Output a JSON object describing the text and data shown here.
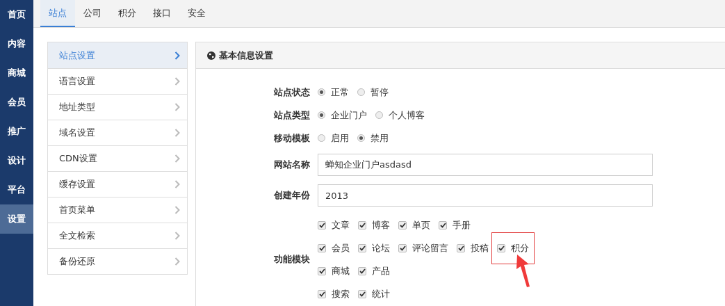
{
  "nav": [
    {
      "label": "首页",
      "selected": false
    },
    {
      "label": "内容",
      "selected": false
    },
    {
      "label": "商城",
      "selected": false
    },
    {
      "label": "会员",
      "selected": false
    },
    {
      "label": "推广",
      "selected": false
    },
    {
      "label": "设计",
      "selected": false
    },
    {
      "label": "平台",
      "selected": false
    },
    {
      "label": "设置",
      "selected": true
    }
  ],
  "tabs": [
    {
      "label": "站点",
      "selected": true
    },
    {
      "label": "公司",
      "selected": false
    },
    {
      "label": "积分",
      "selected": false
    },
    {
      "label": "接口",
      "selected": false
    },
    {
      "label": "安全",
      "selected": false
    }
  ],
  "menu": [
    {
      "label": "站点设置",
      "selected": true
    },
    {
      "label": "语言设置",
      "selected": false
    },
    {
      "label": "地址类型",
      "selected": false
    },
    {
      "label": "域名设置",
      "selected": false
    },
    {
      "label": "CDN设置",
      "selected": false
    },
    {
      "label": "缓存设置",
      "selected": false
    },
    {
      "label": "首页菜单",
      "selected": false
    },
    {
      "label": "全文检索",
      "selected": false
    },
    {
      "label": "备份还原",
      "selected": false
    }
  ],
  "panel": {
    "title": "基本信息设置",
    "fields": [
      {
        "kind": "radio",
        "label": "站点状态",
        "options": [
          {
            "label": "正常",
            "selected": true
          },
          {
            "label": "暂停",
            "selected": false
          }
        ]
      },
      {
        "kind": "radio",
        "label": "站点类型",
        "options": [
          {
            "label": "企业门户",
            "selected": true
          },
          {
            "label": "个人博客",
            "selected": false
          }
        ]
      },
      {
        "kind": "radio",
        "label": "移动模板",
        "options": [
          {
            "label": "启用",
            "selected": false
          },
          {
            "label": "禁用",
            "selected": true
          }
        ]
      },
      {
        "kind": "text",
        "label": "网站名称",
        "value": "蝉知企业门户asdasd"
      },
      {
        "kind": "text",
        "label": "创建年份",
        "value": "2013"
      },
      {
        "kind": "checks",
        "label": "功能模块",
        "rows": [
          [
            {
              "label": "文章",
              "checked": true,
              "highlighted": false
            },
            {
              "label": "博客",
              "checked": true,
              "highlighted": false
            },
            {
              "label": "单页",
              "checked": true,
              "highlighted": false
            },
            {
              "label": "手册",
              "checked": true,
              "highlighted": false
            }
          ],
          [
            {
              "label": "会员",
              "checked": true,
              "highlighted": false
            },
            {
              "label": "论坛",
              "checked": true,
              "highlighted": false
            },
            {
              "label": "评论留言",
              "checked": true,
              "highlighted": false
            },
            {
              "label": "投稿",
              "checked": true,
              "highlighted": false
            },
            {
              "label": "积分",
              "checked": true,
              "highlighted": true
            }
          ],
          [
            {
              "label": "商城",
              "checked": true,
              "highlighted": false
            },
            {
              "label": "产品",
              "checked": true,
              "highlighted": false
            }
          ],
          [
            {
              "label": "搜索",
              "checked": true,
              "highlighted": false
            },
            {
              "label": "统计",
              "checked": true,
              "highlighted": false
            }
          ]
        ]
      }
    ]
  }
}
